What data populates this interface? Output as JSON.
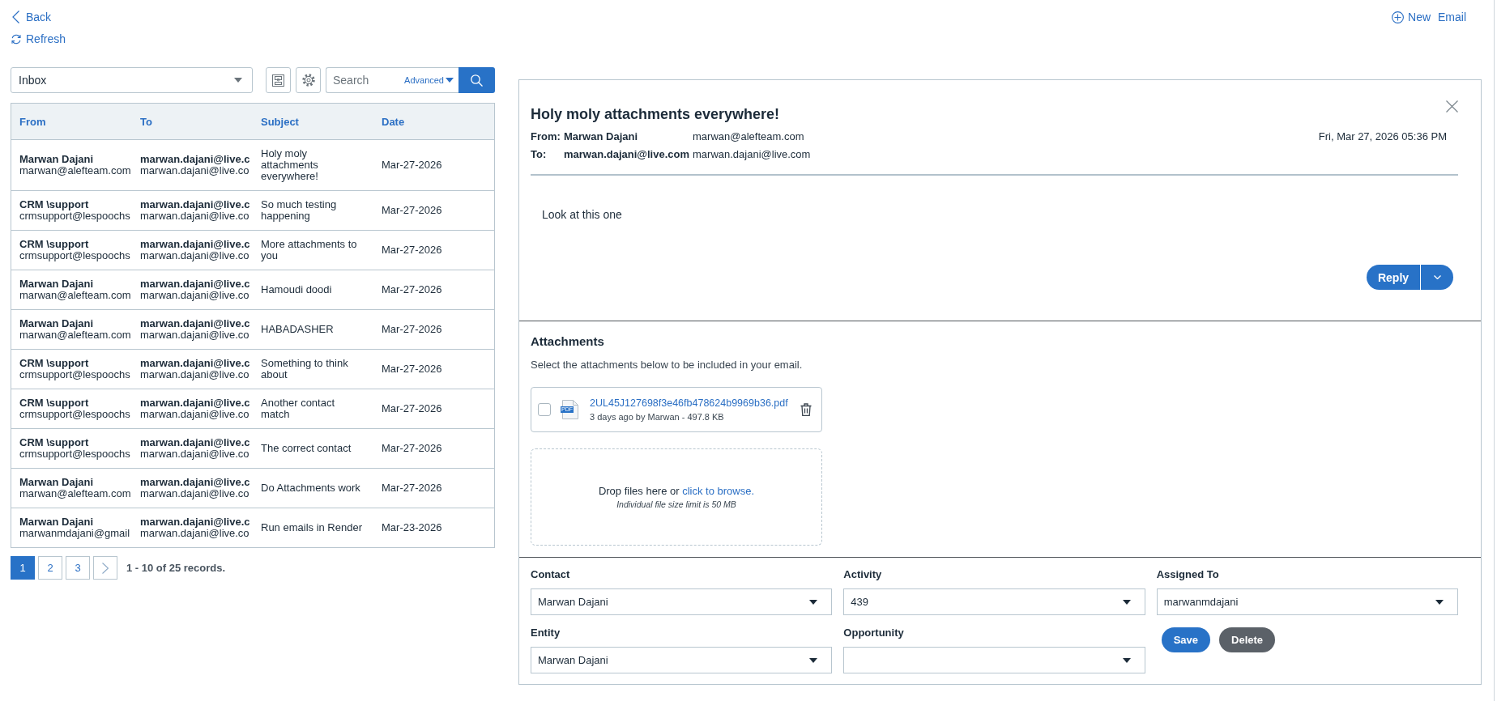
{
  "nav": {
    "back": "Back",
    "refresh": "Refresh",
    "new_email": "New Email"
  },
  "toolbar": {
    "folder": "Inbox",
    "search": {
      "placeholder": "Search",
      "advanced": "Advanced"
    }
  },
  "table": {
    "columns": [
      "From",
      "To",
      "Subject",
      "Date"
    ],
    "rows": [
      {
        "from_name": "Marwan Dajani",
        "from_email": "marwan@alefteam.com",
        "to_name": "marwan.dajani@live.c",
        "to_email": "marwan.dajani@live.co",
        "subject": "Holy moly attachments everywhere!",
        "date": "Mar-27-2026"
      },
      {
        "from_name": "CRM \\support",
        "from_email": "crmsupport@lespoochs",
        "to_name": "marwan.dajani@live.c",
        "to_email": "marwan.dajani@live.co",
        "subject": "So much testing happening",
        "date": "Mar-27-2026"
      },
      {
        "from_name": "CRM \\support",
        "from_email": "crmsupport@lespoochs",
        "to_name": "marwan.dajani@live.c",
        "to_email": "marwan.dajani@live.co",
        "subject": "More attachments to you",
        "date": "Mar-27-2026"
      },
      {
        "from_name": "Marwan Dajani",
        "from_email": "marwan@alefteam.com",
        "to_name": "marwan.dajani@live.c",
        "to_email": "marwan.dajani@live.co",
        "subject": "Hamoudi doodi",
        "date": "Mar-27-2026"
      },
      {
        "from_name": "Marwan Dajani",
        "from_email": "marwan@alefteam.com",
        "to_name": "marwan.dajani@live.c",
        "to_email": "marwan.dajani@live.co",
        "subject": "HABADASHER",
        "date": "Mar-27-2026"
      },
      {
        "from_name": "CRM \\support",
        "from_email": "crmsupport@lespoochs",
        "to_name": "marwan.dajani@live.c",
        "to_email": "marwan.dajani@live.co",
        "subject": "Something to think about",
        "date": "Mar-27-2026"
      },
      {
        "from_name": "CRM \\support",
        "from_email": "crmsupport@lespoochs",
        "to_name": "marwan.dajani@live.c",
        "to_email": "marwan.dajani@live.co",
        "subject": "Another contact match",
        "date": "Mar-27-2026"
      },
      {
        "from_name": "CRM \\support",
        "from_email": "crmsupport@lespoochs",
        "to_name": "marwan.dajani@live.c",
        "to_email": "marwan.dajani@live.co",
        "subject": "The correct contact",
        "date": "Mar-27-2026"
      },
      {
        "from_name": "Marwan Dajani",
        "from_email": "marwan@alefteam.com",
        "to_name": "marwan.dajani@live.c",
        "to_email": "marwan.dajani@live.co",
        "subject": "Do Attachments work",
        "date": "Mar-27-2026"
      },
      {
        "from_name": "Marwan Dajani",
        "from_email": "marwanmdajani@gmail",
        "to_name": "marwan.dajani@live.c",
        "to_email": "marwan.dajani@live.co",
        "subject": "Run emails in Render",
        "date": "Mar-23-2026"
      }
    ]
  },
  "pagination": {
    "pages": [
      {
        "label": "1",
        "selected": true
      },
      {
        "label": "2",
        "selected": false
      },
      {
        "label": "3",
        "selected": false
      }
    ],
    "summary": "1 - 10 of 25 records."
  },
  "email": {
    "subject": "Holy moly attachments everywhere!",
    "from": {
      "label": "From:",
      "name": "Marwan Dajani",
      "address": "marwan@alefteam.com"
    },
    "to": {
      "label": "To:",
      "name": "marwan.dajani@live.com",
      "address": "marwan.dajani@live.com"
    },
    "date": "Fri, Mar 27, 2026 05:36 PM",
    "body": "Look at this one",
    "reply": "Reply"
  },
  "attachments": {
    "title": "Attachments",
    "instructions": "Select the attachments below to be included in your email.",
    "files": [
      {
        "name": "2UL45J127698f3e46fb478624b9969b36.pdf",
        "type": "PDF",
        "meta": "3 days ago by Marwan - 497.8 KB",
        "checked": false
      }
    ],
    "dropzone": {
      "text": "Drop files here or",
      "link": "click to browse.",
      "limit": "Individual file size limit is 50 MB"
    }
  },
  "form": {
    "fields": [
      {
        "label": "Contact",
        "value": "Marwan Dajani"
      },
      {
        "label": "Activity",
        "value": "439"
      },
      {
        "label": "Assigned To",
        "value": "marwanmdajani"
      },
      {
        "label": "Entity",
        "value": "Marwan Dajani"
      },
      {
        "label": "Opportunity"
      }
    ],
    "buttons": [
      {
        "label": "Save",
        "kind": "primary"
      },
      {
        "label": "Delete",
        "kind": "secondary"
      }
    ]
  }
}
